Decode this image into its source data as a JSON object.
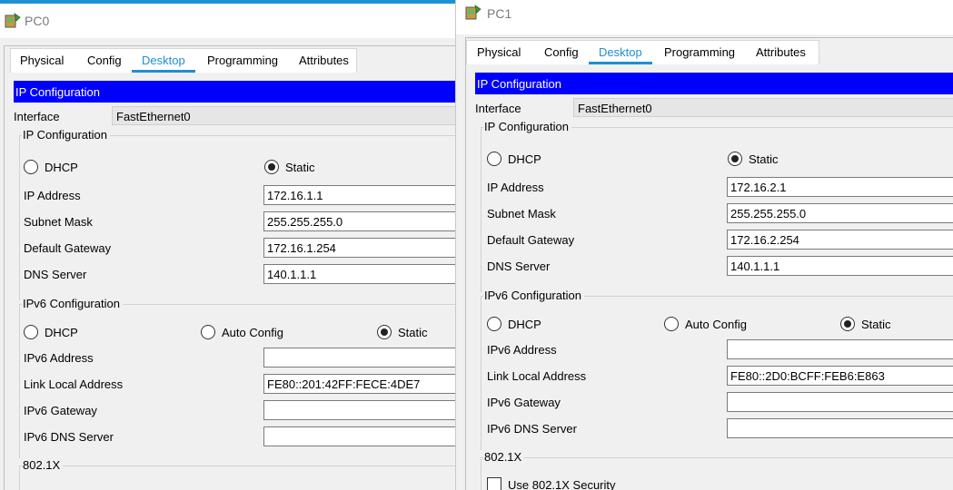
{
  "tabs": [
    "Physical",
    "Config",
    "Desktop",
    "Programming",
    "Attributes"
  ],
  "labels": {
    "header": "IP Configuration",
    "interface": "Interface",
    "ipv4_group": "IP Configuration",
    "dhcp": "DHCP",
    "static": "Static",
    "ip_address": "IP Address",
    "subnet_mask": "Subnet Mask",
    "default_gateway": "Default Gateway",
    "dns_server": "DNS Server",
    "ipv6_group": "IPv6 Configuration",
    "auto_config": "Auto Config",
    "ipv6_address": "IPv6 Address",
    "link_local": "Link Local Address",
    "ipv6_gateway": "IPv6 Gateway",
    "ipv6_dns": "IPv6 DNS Server",
    "dot1x_group": "802.1X",
    "use_8021x": "Use 802.1X Security"
  },
  "pc0": {
    "title": "PC0",
    "active_tab": "Desktop",
    "interface": "FastEthernet0",
    "ipv4_mode": "Static",
    "ip_address": "172.16.1.1",
    "subnet_mask": "255.255.255.0",
    "default_gateway": "172.16.1.254",
    "dns_server": "140.1.1.1",
    "ipv6_mode": "Static",
    "ipv6_address": "",
    "link_local": "FE80::201:42FF:FECE:4DE7",
    "ipv6_gateway": "",
    "ipv6_dns": ""
  },
  "pc1": {
    "title": "PC1",
    "active_tab": "Desktop",
    "interface": "FastEthernet0",
    "ipv4_mode": "Static",
    "ip_address": "172.16.2.1",
    "subnet_mask": "255.255.255.0",
    "default_gateway": "172.16.2.254",
    "dns_server": "140.1.1.1",
    "ipv6_mode": "Static",
    "ipv6_address": "",
    "link_local": "FE80::2D0:BCFF:FEB6:E863",
    "ipv6_gateway": "",
    "ipv6_dns": "",
    "use_8021x": false
  },
  "colors": {
    "accent": "#1f8ed4",
    "header_bg": "#0000ff",
    "titlebar_strip": "#1e90d6"
  },
  "icons": {
    "app": "packet-tracer-pc-icon"
  }
}
